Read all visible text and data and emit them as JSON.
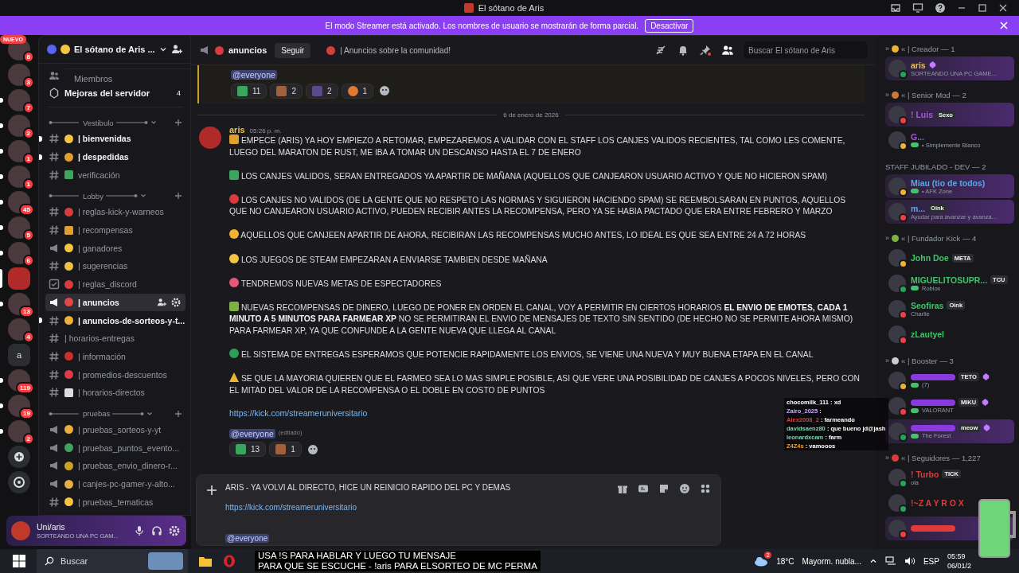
{
  "titlebar": {
    "title": "El sótano de Aris"
  },
  "banner": {
    "text": "El modo Streamer está activado. Los nombres de usuario se mostrarán de forma parcial.",
    "button": "Desactivar"
  },
  "servers": [
    {
      "kind": "avatar",
      "new_label": "NUEVO",
      "badge": "8",
      "unread": false,
      "selected": false
    },
    {
      "kind": "avatar",
      "badge": "3",
      "unread": false,
      "selected": false
    },
    {
      "kind": "avatar",
      "badge": "7",
      "unread": true,
      "selected": false
    },
    {
      "kind": "avatar",
      "badge": "2",
      "unread": true,
      "selected": false
    },
    {
      "kind": "avatar",
      "badge": "1",
      "unread": true,
      "selected": false
    },
    {
      "kind": "avatar",
      "badge": "1",
      "unread": true,
      "selected": false
    },
    {
      "kind": "avatar",
      "badge": "45",
      "unread": true,
      "selected": false
    },
    {
      "kind": "avatar",
      "badge": "5",
      "unread": true,
      "selected": false
    },
    {
      "kind": "avatar",
      "badge": "6",
      "unread": true,
      "selected": false
    },
    {
      "kind": "avatar",
      "selected": true
    },
    {
      "kind": "avatar",
      "badge": "13",
      "unread": true,
      "selected": false
    },
    {
      "kind": "avatar",
      "badge": "4",
      "unread": false,
      "selected": false
    },
    {
      "kind": "letter",
      "letter": "a",
      "unread": false,
      "selected": false
    },
    {
      "kind": "avatar",
      "badge": "119",
      "unread": true,
      "selected": false
    },
    {
      "kind": "avatar",
      "badge": "19",
      "unread": true,
      "selected": false
    },
    {
      "kind": "avatar",
      "badge": "2",
      "unread": true,
      "selected": false
    },
    {
      "kind": "add",
      "unread": false,
      "selected": false
    },
    {
      "kind": "discover",
      "unread": false,
      "selected": false
    }
  ],
  "sidebar": {
    "server_name": "El sótano de Aris ...",
    "links": [
      {
        "kind": "members",
        "label": "Miembros"
      },
      {
        "kind": "boosts",
        "label": "Mejoras del servidor",
        "count": "4"
      }
    ],
    "categories": [
      {
        "label": "Vestibulo",
        "channels": [
          {
            "kind": "text",
            "emoji": {
              "kind": "circle",
              "color": "#f5c542"
            },
            "name": "| bienvenidas",
            "unread": true,
            "selected": false
          },
          {
            "kind": "text",
            "emoji": {
              "kind": "circle",
              "color": "#e0a030"
            },
            "name": "| despedidas",
            "unread": true,
            "selected": false
          },
          {
            "kind": "text",
            "emoji": {
              "kind": "square",
              "color": "#3ba55d"
            },
            "name": "verificación",
            "unread": false,
            "selected": false
          }
        ]
      },
      {
        "label": "Lobby",
        "channels": [
          {
            "kind": "text",
            "emoji": {
              "kind": "circle",
              "color": "#d83c3e"
            },
            "name": "| reglas-kick-y-warneos",
            "unread": false,
            "selected": false
          },
          {
            "kind": "text",
            "emoji": {
              "kind": "square",
              "color": "#e0a030"
            },
            "name": "| recompensas",
            "unread": false,
            "selected": false
          },
          {
            "kind": "announcement",
            "emoji": {
              "kind": "circle",
              "color": "#f5c542"
            },
            "name": "| ganadores",
            "unread": false,
            "selected": false
          },
          {
            "kind": "text",
            "emoji": {
              "kind": "circle",
              "color": "#f0c040"
            },
            "name": "| sugerencias",
            "unread": false,
            "selected": false
          },
          {
            "kind": "rules",
            "emoji": {
              "kind": "circle",
              "color": "#d83c3e"
            },
            "name": "| reglas_discord",
            "unread": false,
            "selected": false
          },
          {
            "kind": "announcement",
            "emoji": {
              "kind": "circle",
              "color": "#e04848"
            },
            "name": "| anuncios",
            "unread": false,
            "selected": true
          },
          {
            "kind": "text",
            "emoji": {
              "kind": "circle",
              "color": "#f0b232"
            },
            "name": "| anuncios-de-sorteos-y-t...",
            "unread": true,
            "selected": false
          },
          {
            "kind": "text",
            "name": "| horarios-entregas",
            "unread": false,
            "selected": false
          },
          {
            "kind": "text",
            "emoji": {
              "kind": "circle",
              "color": "#c83030"
            },
            "name": "| información",
            "unread": false,
            "selected": false
          },
          {
            "kind": "text",
            "emoji": {
              "kind": "circle",
              "color": "#e03a4a"
            },
            "name": "| promedios-descuentos",
            "unread": false,
            "selected": false
          },
          {
            "kind": "text",
            "emoji": {
              "kind": "square",
              "color": "#dddddd"
            },
            "name": "| horarios-directos",
            "unread": false,
            "selected": false
          }
        ]
      },
      {
        "label": "pruebas",
        "channels": [
          {
            "kind": "announcement",
            "emoji": {
              "kind": "circle",
              "color": "#e8b040"
            },
            "name": "| pruebas_sorteos-y-yt",
            "unread": false,
            "selected": false
          },
          {
            "kind": "announcement",
            "emoji": {
              "kind": "circle",
              "color": "#3ba55d"
            },
            "name": "| pruebas_puntos_evento...",
            "unread": false,
            "selected": false
          },
          {
            "kind": "announcement",
            "emoji": {
              "kind": "circle",
              "color": "#c9a227"
            },
            "name": "| pruebas_envio_dinero-r...",
            "unread": false,
            "selected": false
          },
          {
            "kind": "announcement",
            "emoji": {
              "kind": "circle",
              "color": "#e8b040"
            },
            "name": "| canjes-pc-gamer-y-alto...",
            "unread": false,
            "selected": false
          },
          {
            "kind": "text",
            "emoji": {
              "kind": "circle",
              "color": "#f5c542"
            },
            "name": "| pruebas_tematicas",
            "unread": false,
            "selected": false
          }
        ]
      }
    ]
  },
  "user_panel": {
    "name": "Uni/aris",
    "status": "SORTEANDO UNA PC GAM..."
  },
  "header": {
    "channel": "anuncios",
    "follow": "Seguir",
    "topic": "| Anuncios sobre la comunidad!",
    "search_placeholder": "Buscar El sótano de Aris"
  },
  "previous_message": {
    "mention": "@everyone",
    "reactions": [
      {
        "emoji": {
          "kind": "square",
          "color": "#3ba55d"
        },
        "count": "11"
      },
      {
        "emoji": {
          "kind": "square",
          "color": "#a0603a"
        },
        "count": "2"
      },
      {
        "emoji": {
          "kind": "square",
          "color": "#5a4a8a"
        },
        "count": "2"
      },
      {
        "emoji": {
          "kind": "circle",
          "color": "#e07a30"
        },
        "count": "1"
      }
    ]
  },
  "date_divider": "6 de enero de 2026",
  "message": {
    "author": "aris",
    "time": "05:26 p. m.",
    "paragraphs": [
      {
        "emoji": {
          "kind": "square",
          "color": "#e0a030"
        },
        "text": "EMPECE (ARIS) YA HOY EMPIEZO A RETOMAR, EMPEZAREMOS A VALIDAR CON EL STAFF LOS CANJES VALIDOS RECIENTES, TAL COMO LES COMENTE, LUEGO DEL MARATON DE RUST, ME IBA A TOMAR UN DESCANSO HASTA EL 7 DE ENERO"
      },
      {
        "emoji": {
          "kind": "square",
          "color": "#3ba55d"
        },
        "text": "LOS CANJES VALIDOS, SERAN ENTREGADOS YA APARTIR DE MAÑANA (AQUELLOS QUE CANJEARON USUARIO ACTIVO Y QUE NO HICIERON SPAM)"
      },
      {
        "emoji": {
          "kind": "circle",
          "color": "#d83c3e"
        },
        "text": "LOS CANJES NO VALIDOS (DE LA GENTE QUE NO RESPETO LAS NORMAS Y SIGUIERON HACIENDO SPAM) SE REEMBOLSARAN EN PUNTOS, AQUELLOS QUE NO CANJEARON USUARIO ACTIVO, PUEDEN RECIBIR ANTES LA RECOMPENSA, PERO YA SE HABIA PACTADO QUE ERA ENTRE FEBRERO Y MARZO"
      },
      {
        "emoji": {
          "kind": "circle",
          "color": "#f0b232"
        },
        "text": "AQUELLOS QUE CANJEEN APARTIR DE AHORA, RECIBIRAN LAS RECOMPENSAS MUCHO ANTES, LO IDEAL ES QUE SEA ENTRE 24 A 72 HORAS"
      },
      {
        "emoji": {
          "kind": "circle",
          "color": "#f5c542"
        },
        "text": "LOS JUEGOS DE STEAM EMPEZARAN A ENVIARSE TAMBIEN DESDE MAÑANA"
      },
      {
        "emoji": {
          "kind": "circle",
          "color": "#e8577a"
        },
        "text": "TENDREMOS NUEVAS METAS DE ESPECTADORES"
      },
      {
        "emoji": {
          "kind": "square",
          "color": "#7cb342"
        },
        "text": "NUEVAS RECOMPENSAS DE DINERO, LUEGO DE PONER EN ORDEN EL CANAL, VOY A PERMITIR EN CIERTOS HORARIOS **EL ENVIO DE EMOTES, CADA 1 MINUTO A 5 MINUTOS PARA FARMEAR XP** NO SE PERMITIRAN EL ENVIO DE MENSAJES DE TEXTO SIN SENTIDO (DE HECHO NO SE PERMITE AHORA MISMO) PARA FARMEAR XP, YA QUE CONFUNDE A LA GENTE NUEVA QUE LLEGA AL CANAL"
      },
      {
        "emoji": {
          "kind": "circle",
          "color": "#2e9e55"
        },
        "text": "EL SISTEMA DE ENTREGAS ESPERAMOS QUE POTENCIE RAPIDAMENTE LOS ENVIOS, SE VIENE UNA NUEVA Y MUY BUENA ETAPA EN EL CANAL"
      },
      {
        "emoji": {
          "kind": "triangle",
          "color": "#f0b232"
        },
        "text": "SE QUE LA MAYORIA QUIEREN QUE EL FARMEO SEA LO MAS SIMPLE POSIBLE, ASI QUE VERE UNA POSIBILIDAD DE CANJES A POCOS NIVELES, PERO CON EL MITAD DEL VALOR DE LA RECOMPENSA O EL DOBLE EN COSTO DE PUNTOS"
      }
    ],
    "link": "https://kick.com/streameruniversitario",
    "mention": "@everyone",
    "edited": "(editado)",
    "reactions": [
      {
        "emoji": {
          "kind": "square",
          "color": "#3ba55d"
        },
        "count": "13"
      },
      {
        "emoji": {
          "kind": "square",
          "color": "#a0603a"
        },
        "count": "1"
      }
    ]
  },
  "composer": {
    "lines": [
      {
        "kind": "text",
        "text": "ARIS - YA VOLVI AL DIRECTO, HICE UN REINICIO RAPIDO DEL PC Y DEMAS"
      },
      {
        "kind": "link",
        "text": "https://kick.com/streameruniversitario"
      },
      {
        "kind": "mention",
        "text": "@everyone"
      }
    ]
  },
  "members": [
    {
      "pre": "»",
      "emoji": {
        "kind": "circle",
        "color": "#f0b232"
      },
      "label": "« | Creador — 1",
      "items": [
        {
          "name": "aris",
          "color": "#e8c34a",
          "boosting": true,
          "kind": "streaming",
          "nameplate": true,
          "sub": "SORTEANDO UNA PC GAME..."
        }
      ]
    },
    {
      "pre": "»",
      "emoji": {
        "kind": "circle",
        "color": "#c97a3a"
      },
      "label": "« | Senior Mod — 2",
      "items": [
        {
          "name": "! Luis",
          "color": "#a259d9",
          "kind": "dnd",
          "nameplate": true,
          "tag": "Sexo"
        },
        {
          "name": "G...",
          "color": "#a259d9",
          "kind": "idle",
          "nameplate": false,
          "game": true,
          "sub": "• Simplemente Blanco"
        }
      ]
    },
    {
      "label": "STAFF JUBILADO - DEV — 2",
      "items": [
        {
          "name": "Miau (tio de todos)",
          "color": "#5aa6e8",
          "kind": "idle",
          "nameplate": true,
          "game": true,
          "sub": "• AFK Zone"
        },
        {
          "name": "m...",
          "color": "#5aa6e8",
          "kind": "dnd",
          "nameplate": true,
          "tag": "Oink",
          "sub": "Ayudar para avanzar y avanza..."
        }
      ]
    },
    {
      "pre": "»",
      "emoji": {
        "kind": "circle",
        "color": "#7cb342"
      },
      "label": "« | Fundador Kick — 4",
      "items": [
        {
          "name": "John Doe",
          "color": "#3fc46a",
          "kind": "idle",
          "nameplate": false,
          "tag": "META"
        },
        {
          "name": "MIGUELITOSUPR...",
          "color": "#3fc46a",
          "kind": "online",
          "nameplate": false,
          "tag": "TCU",
          "game": true,
          "sub": "Roblox"
        },
        {
          "name": "Seofiras",
          "color": "#3fc46a",
          "kind": "dnd",
          "nameplate": false,
          "tag": "Oink",
          "sub": "Charlie"
        },
        {
          "name": "zLautyel",
          "color": "#3fc46a",
          "kind": "dnd",
          "nameplate": false
        }
      ]
    },
    {
      "pre": "»",
      "emoji": {
        "kind": "circle",
        "color": "#cccccc"
      },
      "label": "« | Booster — 3",
      "items": [
        {
          "color": "#8a3be0",
          "kind": "idle",
          "nameplate": false,
          "tag": "TETO",
          "boosting": true,
          "game": true,
          "sub": "(7)"
        },
        {
          "color": "#8a3be0",
          "kind": "dnd",
          "nameplate": false,
          "tag": "MIKU",
          "boosting": true,
          "game": true,
          "sub": "VALORANT"
        },
        {
          "color": "#8a3be0",
          "kind": "online",
          "nameplate": true,
          "tag": "meow",
          "boosting": true,
          "game": true,
          "sub": "The Forest"
        }
      ]
    },
    {
      "pre": "»",
      "emoji": {
        "kind": "circle",
        "color": "#d83c3e"
      },
      "label": "« | Seguidores — 1,227",
      "items": [
        {
          "name": "! Turbo",
          "color": "#e03a3a",
          "kind": "online",
          "nameplate": false,
          "tag": "TICK",
          "sub": "ola"
        },
        {
          "name": "!~Z A Y R O X",
          "color": "#e03a3a",
          "kind": "online",
          "nameplate": false
        },
        {
          "color": "#e03a3a",
          "kind": "dnd",
          "nameplate": true
        }
      ]
    }
  ],
  "stream_chat": [
    {
      "user": "chocomilk_111",
      "text": ": xd",
      "color": "#ffffff"
    },
    {
      "user": "Zairo_2025",
      "text": ":",
      "color": "#c8a8ff"
    },
    {
      "user": "Alex2008_2",
      "text": ": farmeando",
      "color": "#e53935"
    },
    {
      "user": "davidsaenz80",
      "text": ": que bueno jd@jash",
      "color": "#7fd4b0"
    },
    {
      "user": "leonardxcam",
      "text": ": farm",
      "color": "#7fd4b0"
    },
    {
      "user": "Z4Z4s",
      "text": ": vamooos",
      "color": "#f0a030"
    }
  ],
  "taskbar": {
    "search": "Buscar",
    "subtitle": [
      "USA !S PARA HABLAR Y LUEGO TU MENSAJE",
      "PARA QUE SE ESCUCHE - !aris PARA ELSORTEO DE MC PERMA"
    ],
    "weather_badge": "2",
    "temperature": "18°C",
    "weather": "Mayorm. nubla...",
    "language": "ESP",
    "time": "05:59",
    "date": "06/01/2"
  }
}
